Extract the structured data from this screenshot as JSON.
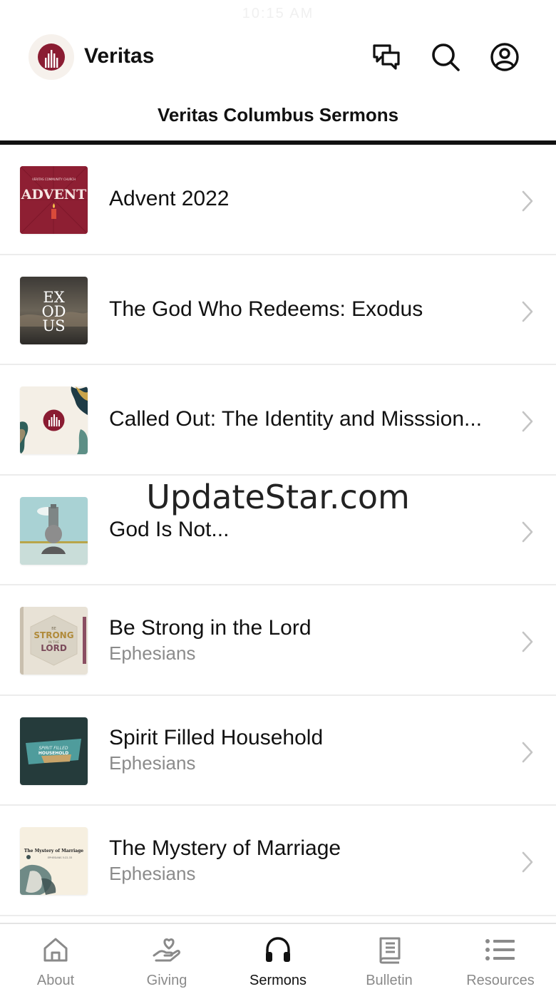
{
  "status_bar": {
    "time": "10:15 AM"
  },
  "header": {
    "app_title": "Veritas",
    "icons": [
      "chat-icon",
      "search-icon",
      "account-icon"
    ]
  },
  "page": {
    "title": "Veritas Columbus Sermons"
  },
  "sermons": [
    {
      "title": "Advent 2022",
      "subtitle": "",
      "art": "advent-art"
    },
    {
      "title": "The God Who Redeems: Exodus",
      "subtitle": "",
      "art": "exodus-art"
    },
    {
      "title": "Called Out: The Identity and Misssion...",
      "subtitle": "",
      "art": "called-out-art"
    },
    {
      "title": "God Is Not...",
      "subtitle": "",
      "art": "god-is-not-art"
    },
    {
      "title": "Be Strong in the Lord",
      "subtitle": "Ephesians",
      "art": "be-strong-art"
    },
    {
      "title": "Spirit Filled Household",
      "subtitle": "Ephesians",
      "art": "spirit-filled-art"
    },
    {
      "title": "The Mystery of Marriage",
      "subtitle": "Ephesians",
      "art": "mystery-marriage-art"
    }
  ],
  "art_text": {
    "advent_small": "VERITAS COMMUNITY CHURCH",
    "advent_big": "ADVENT",
    "exodus": [
      "EX",
      "OD",
      "US"
    ],
    "be_strong_top": "BE",
    "be_strong_mid": "STRONG",
    "be_strong_small": "IN THE",
    "be_strong_bottom": "LORD",
    "spirit_line1": "SPIRIT FILLED",
    "spirit_line2": "HOUSEHOLD",
    "mystery_title": "The Mystery of Marriage",
    "mystery_ref": "EPHESIANS 5:22-33"
  },
  "watermark": "UpdateStar.com",
  "tabs": [
    {
      "label": "About",
      "icon": "home-icon",
      "active": false
    },
    {
      "label": "Giving",
      "icon": "giving-heart-hand-icon",
      "active": false
    },
    {
      "label": "Sermons",
      "icon": "headphones-icon",
      "active": true
    },
    {
      "label": "Bulletin",
      "icon": "bulletin-book-icon",
      "active": false
    },
    {
      "label": "Resources",
      "icon": "list-icon",
      "active": false
    }
  ],
  "colors": {
    "brand": "#8a1c32",
    "text": "#111111",
    "secondary_text": "#8b8b8b",
    "tab_inactive": "#8a8a8a"
  }
}
